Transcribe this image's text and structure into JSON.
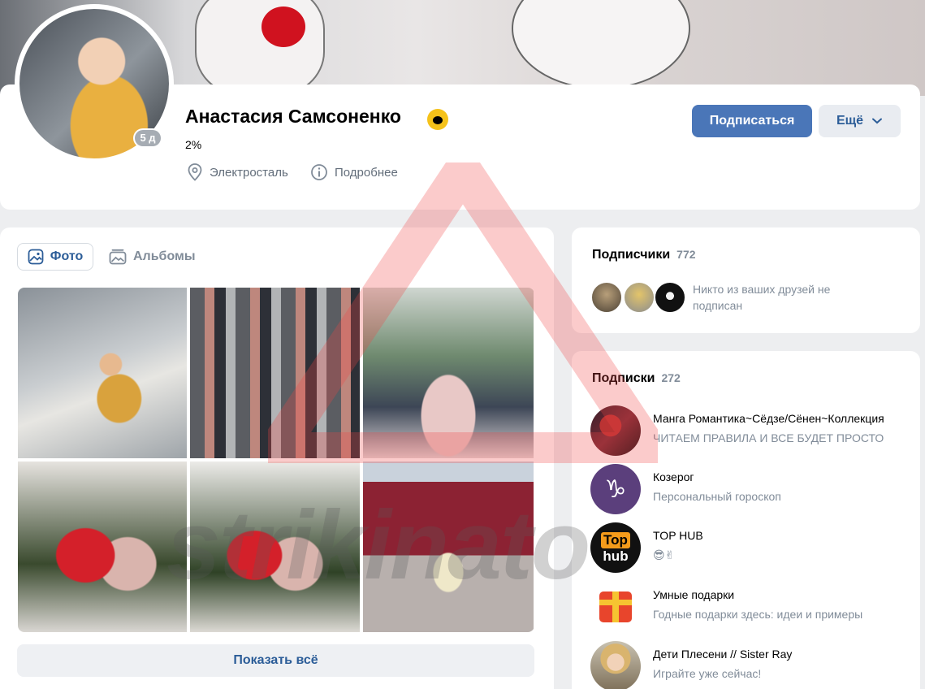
{
  "profile": {
    "name": "Анастасия Самсоненко",
    "status": "2%",
    "online": "5 д",
    "location": "Электросталь",
    "more_info": "Подробнее",
    "subscribe_label": "Подписаться",
    "more_label": "Ещё"
  },
  "photos": {
    "tab_photo": "Фото",
    "tab_albums": "Альбомы",
    "show_all": "Показать всё"
  },
  "followers": {
    "title": "Подписчики",
    "count": "772",
    "note": "Никто из ваших друзей не подписан"
  },
  "subscriptions": {
    "title": "Подписки",
    "count": "272",
    "items": [
      {
        "name": "Манга Романтика~Сёдзе/Сёнен~Коллекция",
        "desc": "ЧИТАЕМ ПРАВИЛА И ВСЕ БУДЕТ ПРОСТО"
      },
      {
        "name": "Козерог",
        "desc": "Персональный гороскоп"
      },
      {
        "name": "TOP HUB",
        "desc": "😎✌"
      },
      {
        "name": "Умные подарки",
        "desc": "Годные подарки здесь: идеи и примеры"
      },
      {
        "name": "Дети Плесени // Sister Ray",
        "desc": "Играйте уже сейчас!"
      }
    ]
  },
  "icons": {
    "tophub_top": "Top",
    "tophub_hub": "hub",
    "goat": "♑"
  },
  "watermark": "strikinato",
  "colors": {
    "accent": "#4a76b8",
    "link": "#2c5d98",
    "muted": "#818c99",
    "background": "#edeef0"
  }
}
